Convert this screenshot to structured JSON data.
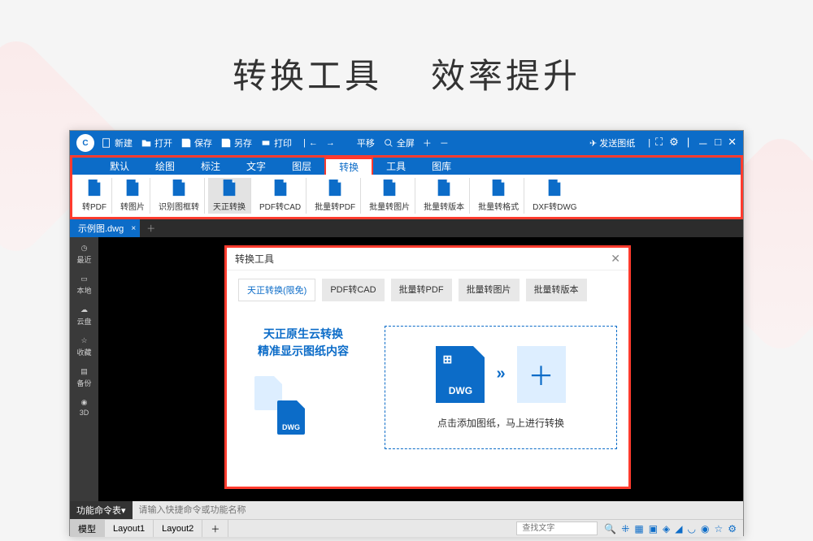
{
  "hero": {
    "left": "转换工具",
    "right": "效率提升"
  },
  "titlebar": {
    "new": "新建",
    "open": "打开",
    "save": "保存",
    "saveas": "另存",
    "print": "打印",
    "pan": "平移",
    "fullscreen": "全屏",
    "send": "发送图纸"
  },
  "menus": [
    "默认",
    "绘图",
    "标注",
    "文字",
    "图层",
    "转换",
    "工具",
    "图库"
  ],
  "menu_active_index": 5,
  "ribbon": [
    {
      "label": "转PDF"
    },
    {
      "label": "转图片"
    },
    {
      "label": "识别图框转"
    },
    {
      "label": "天正转换"
    },
    {
      "label": "PDF转CAD"
    },
    {
      "label": "批量转PDF"
    },
    {
      "label": "批量转图片"
    },
    {
      "label": "批量转版本"
    },
    {
      "label": "批量转格式"
    },
    {
      "label": "DXF转DWG"
    }
  ],
  "ribbon_active_index": 3,
  "file_tab": "示例图.dwg",
  "sidebar": [
    {
      "label": "最近"
    },
    {
      "label": "本地"
    },
    {
      "label": "云盘"
    },
    {
      "label": "收藏"
    },
    {
      "label": "备份"
    },
    {
      "label": "3D"
    }
  ],
  "dialog": {
    "title": "转换工具",
    "tabs": [
      "天正转换(限免)",
      "PDF转CAD",
      "批量转PDF",
      "批量转图片",
      "批量转版本"
    ],
    "tab_active_index": 0,
    "promo_line1": "天正原生云转换",
    "promo_line2": "精准显示图纸内容",
    "dwg_label": "DWG",
    "drop_text": "点击添加图纸，马上进行转换"
  },
  "cmd": {
    "label": "功能命令表",
    "placeholder": "请输入快捷命令或功能名称"
  },
  "status": {
    "tabs": [
      "模型",
      "Layout1",
      "Layout2"
    ],
    "search_placeholder": "查找文字"
  }
}
